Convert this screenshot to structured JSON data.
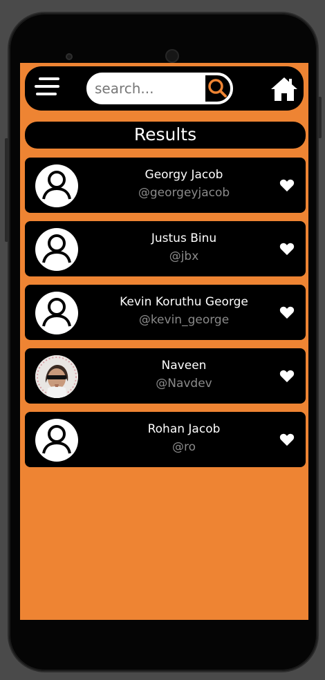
{
  "search": {
    "placeholder": "search..."
  },
  "header": {
    "title": "Results"
  },
  "colors": {
    "accent": "#ee8433",
    "card": "#000000",
    "handle": "#8a8a8a"
  },
  "results": [
    {
      "name": "Georgy Jacob",
      "handle": "@georgeyjacob",
      "avatar": "default-user-icon"
    },
    {
      "name": "Justus Binu",
      "handle": "@jbx",
      "avatar": "default-user-icon"
    },
    {
      "name": "Kevin Koruthu George",
      "handle": "@kevin_george",
      "avatar": "default-user-icon"
    },
    {
      "name": "Naveen",
      "handle": "@Navdev",
      "avatar": "profile-photo"
    },
    {
      "name": "Rohan Jacob",
      "handle": "@ro",
      "avatar": "default-user-icon"
    }
  ]
}
